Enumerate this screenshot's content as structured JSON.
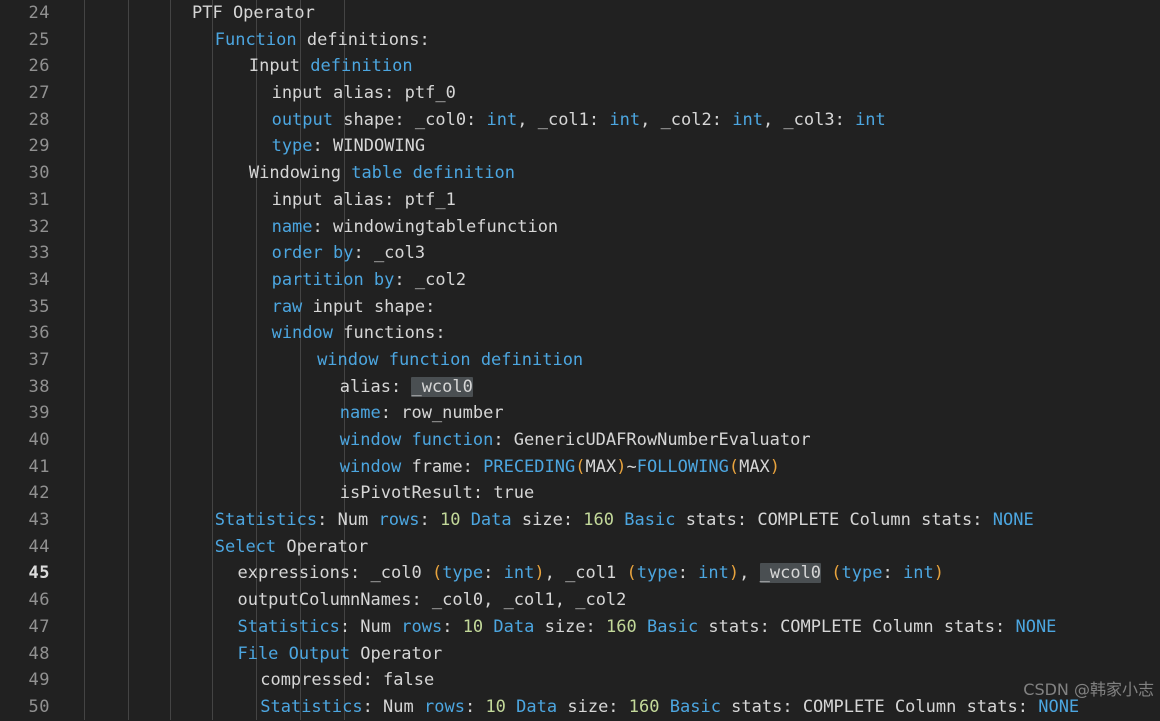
{
  "editor": {
    "theme": "dark",
    "background": "#212121",
    "gutter_color": "#919191",
    "active_line_number": "45",
    "first_line": 24,
    "colors": {
      "keyword": "#4ca6e0",
      "text": "#d6d6d6",
      "number": "#c3d99a",
      "paren": "#e8a33d",
      "highlight_bg": "#4a4f52",
      "indent_guide": "#4a4a4a"
    }
  },
  "line_numbers": [
    "24",
    "25",
    "26",
    "27",
    "28",
    "29",
    "30",
    "31",
    "32",
    "33",
    "34",
    "35",
    "36",
    "37",
    "38",
    "39",
    "40",
    "41",
    "42",
    "43",
    "44",
    "45",
    "46",
    "47",
    "48",
    "49",
    "50"
  ],
  "indent_guides_x": [
    84,
    128,
    170,
    212,
    256,
    300,
    344
  ],
  "lines": [
    {
      "n": "24",
      "indent": 0,
      "tokens": [
        {
          "t": "PTF Operator",
          "c": "tx"
        }
      ]
    },
    {
      "n": "25",
      "indent": 2,
      "tokens": [
        {
          "t": "Function",
          "c": "kw"
        },
        {
          "t": " definitions:",
          "c": "tx"
        }
      ]
    },
    {
      "n": "26",
      "indent": 5,
      "tokens": [
        {
          "t": "Input ",
          "c": "tx"
        },
        {
          "t": "definition",
          "c": "kw"
        }
      ]
    },
    {
      "n": "27",
      "indent": 7,
      "tokens": [
        {
          "t": "input alias: ptf_0",
          "c": "tx"
        }
      ]
    },
    {
      "n": "28",
      "indent": 7,
      "tokens": [
        {
          "t": "output",
          "c": "kw"
        },
        {
          "t": " shape: _col0: ",
          "c": "tx"
        },
        {
          "t": "int",
          "c": "kw"
        },
        {
          "t": ", _col1: ",
          "c": "tx"
        },
        {
          "t": "int",
          "c": "kw"
        },
        {
          "t": ", _col2: ",
          "c": "tx"
        },
        {
          "t": "int",
          "c": "kw"
        },
        {
          "t": ", _col3: ",
          "c": "tx"
        },
        {
          "t": "int",
          "c": "kw"
        }
      ]
    },
    {
      "n": "29",
      "indent": 7,
      "tokens": [
        {
          "t": "type",
          "c": "kw"
        },
        {
          "t": ": WINDOWING",
          "c": "tx"
        }
      ]
    },
    {
      "n": "30",
      "indent": 5,
      "tokens": [
        {
          "t": "Windowing ",
          "c": "tx"
        },
        {
          "t": "table definition",
          "c": "kw"
        }
      ]
    },
    {
      "n": "31",
      "indent": 7,
      "tokens": [
        {
          "t": "input alias: ptf_1",
          "c": "tx"
        }
      ]
    },
    {
      "n": "32",
      "indent": 7,
      "tokens": [
        {
          "t": "name",
          "c": "kw"
        },
        {
          "t": ": windowingtablefunction",
          "c": "tx"
        }
      ]
    },
    {
      "n": "33",
      "indent": 7,
      "tokens": [
        {
          "t": "order by",
          "c": "kw"
        },
        {
          "t": ": _col3",
          "c": "tx"
        }
      ]
    },
    {
      "n": "34",
      "indent": 7,
      "tokens": [
        {
          "t": "partition by",
          "c": "kw"
        },
        {
          "t": ": _col2",
          "c": "tx"
        }
      ]
    },
    {
      "n": "35",
      "indent": 7,
      "tokens": [
        {
          "t": "raw",
          "c": "kw"
        },
        {
          "t": " input shape:",
          "c": "tx"
        }
      ]
    },
    {
      "n": "36",
      "indent": 7,
      "tokens": [
        {
          "t": "window",
          "c": "kw"
        },
        {
          "t": " functions:",
          "c": "tx"
        }
      ]
    },
    {
      "n": "37",
      "indent": 11,
      "tokens": [
        {
          "t": "window function definition",
          "c": "kw"
        }
      ]
    },
    {
      "n": "38",
      "indent": 13,
      "tokens": [
        {
          "t": "alias: ",
          "c": "tx"
        },
        {
          "t": "_wcol0",
          "c": "tx hl"
        }
      ]
    },
    {
      "n": "39",
      "indent": 13,
      "tokens": [
        {
          "t": "name",
          "c": "kw"
        },
        {
          "t": ": row_number",
          "c": "tx"
        }
      ]
    },
    {
      "n": "40",
      "indent": 13,
      "tokens": [
        {
          "t": "window function",
          "c": "kw"
        },
        {
          "t": ": GenericUDAFRowNumberEvaluator",
          "c": "tx"
        }
      ]
    },
    {
      "n": "41",
      "indent": 13,
      "tokens": [
        {
          "t": "window",
          "c": "kw"
        },
        {
          "t": " frame: ",
          "c": "tx"
        },
        {
          "t": "PRECEDING",
          "c": "kw"
        },
        {
          "t": "(",
          "c": "pn"
        },
        {
          "t": "MAX",
          "c": "tx"
        },
        {
          "t": ")",
          "c": "pn"
        },
        {
          "t": "~",
          "c": "tx"
        },
        {
          "t": "FOLLOWING",
          "c": "kw"
        },
        {
          "t": "(",
          "c": "pn"
        },
        {
          "t": "MAX",
          "c": "tx"
        },
        {
          "t": ")",
          "c": "pn"
        }
      ]
    },
    {
      "n": "42",
      "indent": 13,
      "tokens": [
        {
          "t": "isPivotResult: true",
          "c": "tx"
        }
      ]
    },
    {
      "n": "43",
      "indent": 2,
      "tokens": [
        {
          "t": "Statistics",
          "c": "kw"
        },
        {
          "t": ": Num ",
          "c": "tx"
        },
        {
          "t": "rows",
          "c": "kw"
        },
        {
          "t": ": ",
          "c": "tx"
        },
        {
          "t": "10",
          "c": "num"
        },
        {
          "t": " ",
          "c": "tx"
        },
        {
          "t": "Data",
          "c": "kw"
        },
        {
          "t": " size: ",
          "c": "tx"
        },
        {
          "t": "160",
          "c": "num"
        },
        {
          "t": " ",
          "c": "tx"
        },
        {
          "t": "Basic",
          "c": "kw"
        },
        {
          "t": " stats: COMPLETE Column stats: ",
          "c": "tx"
        },
        {
          "t": "NONE",
          "c": "kw"
        }
      ]
    },
    {
      "n": "44",
      "indent": 2,
      "tokens": [
        {
          "t": "Select",
          "c": "kw"
        },
        {
          "t": " Operator",
          "c": "tx"
        }
      ]
    },
    {
      "n": "45",
      "indent": 4,
      "tokens": [
        {
          "t": "expressions: _col0 ",
          "c": "tx"
        },
        {
          "t": "(",
          "c": "pn"
        },
        {
          "t": "type",
          "c": "kw"
        },
        {
          "t": ": ",
          "c": "tx"
        },
        {
          "t": "int",
          "c": "kw"
        },
        {
          "t": ")",
          "c": "pn"
        },
        {
          "t": ", _col1 ",
          "c": "tx"
        },
        {
          "t": "(",
          "c": "pn"
        },
        {
          "t": "type",
          "c": "kw"
        },
        {
          "t": ": ",
          "c": "tx"
        },
        {
          "t": "int",
          "c": "kw"
        },
        {
          "t": ")",
          "c": "pn"
        },
        {
          "t": ", ",
          "c": "tx"
        },
        {
          "t": "_wcol0",
          "c": "tx hl"
        },
        {
          "t": " ",
          "c": "tx"
        },
        {
          "t": "(",
          "c": "pn"
        },
        {
          "t": "type",
          "c": "kw"
        },
        {
          "t": ": ",
          "c": "tx"
        },
        {
          "t": "int",
          "c": "kw"
        },
        {
          "t": ")",
          "c": "pn"
        }
      ]
    },
    {
      "n": "46",
      "indent": 4,
      "tokens": [
        {
          "t": "outputColumnNames: _col0, _col1, _col2",
          "c": "tx"
        }
      ]
    },
    {
      "n": "47",
      "indent": 4,
      "tokens": [
        {
          "t": "Statistics",
          "c": "kw"
        },
        {
          "t": ": Num ",
          "c": "tx"
        },
        {
          "t": "rows",
          "c": "kw"
        },
        {
          "t": ": ",
          "c": "tx"
        },
        {
          "t": "10",
          "c": "num"
        },
        {
          "t": " ",
          "c": "tx"
        },
        {
          "t": "Data",
          "c": "kw"
        },
        {
          "t": " size: ",
          "c": "tx"
        },
        {
          "t": "160",
          "c": "num"
        },
        {
          "t": " ",
          "c": "tx"
        },
        {
          "t": "Basic",
          "c": "kw"
        },
        {
          "t": " stats: COMPLETE Column stats: ",
          "c": "tx"
        },
        {
          "t": "NONE",
          "c": "kw"
        }
      ]
    },
    {
      "n": "48",
      "indent": 4,
      "tokens": [
        {
          "t": "File Output",
          "c": "kw"
        },
        {
          "t": " Operator",
          "c": "tx"
        }
      ]
    },
    {
      "n": "49",
      "indent": 6,
      "tokens": [
        {
          "t": "compressed: false",
          "c": "tx"
        }
      ]
    },
    {
      "n": "50",
      "indent": 6,
      "tokens": [
        {
          "t": "Statistics",
          "c": "kw"
        },
        {
          "t": ": Num ",
          "c": "tx"
        },
        {
          "t": "rows",
          "c": "kw"
        },
        {
          "t": ": ",
          "c": "tx"
        },
        {
          "t": "10",
          "c": "num"
        },
        {
          "t": " ",
          "c": "tx"
        },
        {
          "t": "Data",
          "c": "kw"
        },
        {
          "t": " size: ",
          "c": "tx"
        },
        {
          "t": "160",
          "c": "num"
        },
        {
          "t": " ",
          "c": "tx"
        },
        {
          "t": "Basic",
          "c": "kw"
        },
        {
          "t": " stats: COMPLETE Column stats: ",
          "c": "tx"
        },
        {
          "t": "NONE",
          "c": "kw"
        }
      ]
    }
  ],
  "watermark": {
    "text": "CSDN @韩家小志"
  }
}
